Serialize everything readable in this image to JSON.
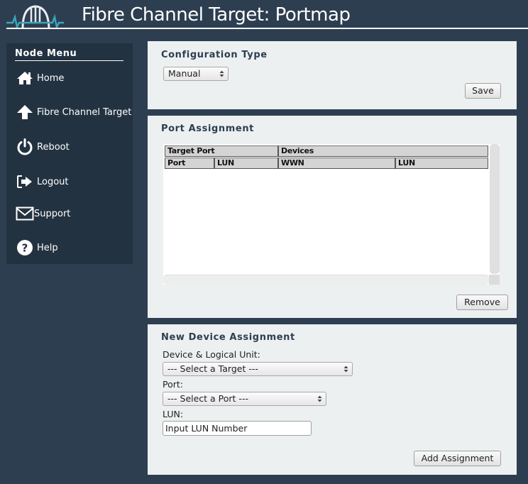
{
  "header": {
    "title": "Fibre Channel Target: Portmap",
    "logo_icon": "bridge-logo-icon"
  },
  "sidebar": {
    "title": "Node Menu",
    "items": [
      {
        "label": "Home",
        "icon": "home-icon"
      },
      {
        "label": "Fibre Channel Target",
        "icon": "arrow-up-icon"
      },
      {
        "label": "Reboot",
        "icon": "power-icon"
      },
      {
        "label": "Logout",
        "icon": "logout-icon"
      },
      {
        "label": "Support",
        "icon": "envelope-icon"
      },
      {
        "label": "Help",
        "icon": "question-circle-icon"
      }
    ]
  },
  "config": {
    "title": "Configuration Type",
    "select_value": "Manual",
    "save_label": "Save"
  },
  "port_assignment": {
    "title": "Port Assignment",
    "group_headers": [
      "Target Port",
      "Devices"
    ],
    "columns": [
      "Port",
      "LUN",
      "WWN",
      "LUN"
    ],
    "rows": [],
    "remove_label": "Remove"
  },
  "new_device": {
    "title": "New Device Assignment",
    "device_label": "Device & Logical Unit:",
    "device_select_value": "--- Select a Target ---",
    "port_label": "Port:",
    "port_select_value": "--- Select a Port ---",
    "lun_label": "LUN:",
    "lun_input_value": "Input LUN Number",
    "add_label": "Add Assignment"
  },
  "colors": {
    "background": "#2d3e50",
    "sidebar": "#233241",
    "panel": "#ecf0f1",
    "logo_accent": "#3aa6b9"
  }
}
